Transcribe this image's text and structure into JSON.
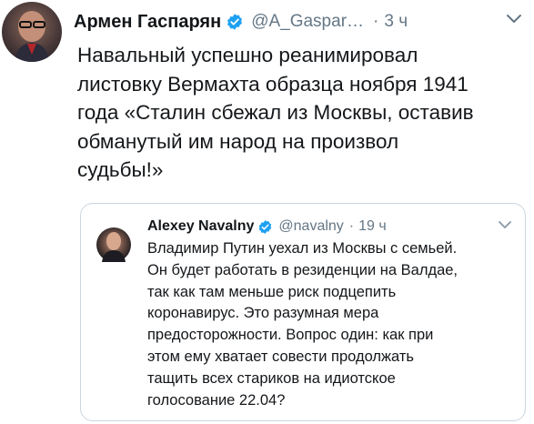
{
  "tweet": {
    "author_name": "Армен Гаспарян",
    "handle": "@A_Gaspar…",
    "separator": "·",
    "time": "3 ч",
    "text": "Навальный успешно реанимировал\nлистовку Вермахта образца ноября 1941\nгода «Сталин сбежал из Москвы, оставив\nобманутый им народ на произвол\nсудьбы!»"
  },
  "quoted_tweet": {
    "author_name": "Alexey Navalny",
    "handle": "@navalny",
    "separator": "·",
    "time": "19 ч",
    "text": "Владимир Путин уехал из Москвы с семьей.\nОн будет работать в резиденции на Валдае,\nтак как там меньше риск подцепить\nкоронавирус. Это разумная мера\nпредосторожности. Вопрос один: как при\nэтом ему хватает совести продолжать\nтащить всех стариков на идиотское\nголосование 22.04?"
  },
  "icons": {
    "verified": "verified-badge-icon",
    "menu": "chevron-down-icon",
    "avatar": "avatar"
  },
  "colors": {
    "verified_blue": "#1da1f2",
    "secondary_text": "#657786",
    "border": "#ccd6dd"
  }
}
